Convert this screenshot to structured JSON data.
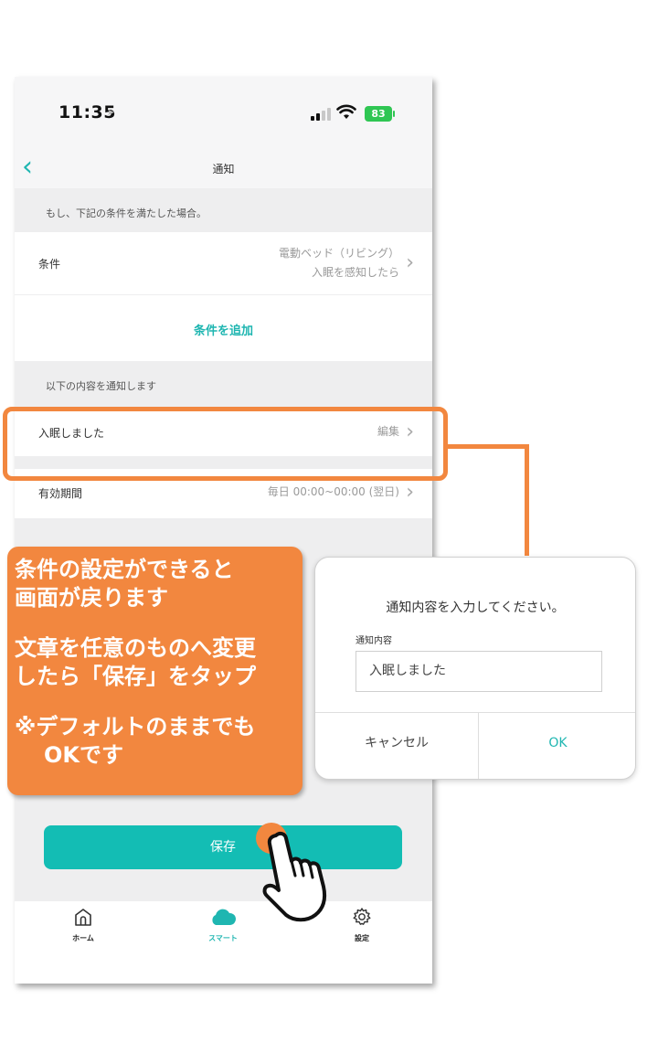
{
  "statusbar": {
    "time": "11:35",
    "location_glyph": "➤",
    "battery": "83"
  },
  "navbar": {
    "back": "‹",
    "title": "通知"
  },
  "condition_section": {
    "header": "もし、下記の条件を満たした場合。",
    "row_label": "条件",
    "row_value_line1": "電動ベッド（リビング）",
    "row_value_line2": "入眠を感知したら",
    "add_link": "条件を追加"
  },
  "notify_section": {
    "header": "以下の内容を通知します",
    "row_label": "入眠しました",
    "row_value": "編集"
  },
  "period_row": {
    "label": "有効期間",
    "value": "毎日 00:00~00:00 (翌日)"
  },
  "save_button": "保存",
  "tabbar": {
    "items": [
      {
        "label": "ホーム",
        "icon": "home-icon"
      },
      {
        "label": "スマート",
        "icon": "cloud-icon"
      },
      {
        "label": "設定",
        "icon": "gear-icon"
      }
    ]
  },
  "callout": {
    "lines1": [
      "条件の設定ができると",
      "画面が戻ります"
    ],
    "lines2": [
      "文章を任意のものへ変更",
      "したら「保存」をタップ"
    ],
    "lines3": [
      "※デフォルトのままでも",
      "OKです"
    ]
  },
  "dialog": {
    "title": "通知内容を入力してください。",
    "field_label": "通知内容",
    "field_value": "入眠しました",
    "cancel": "キャンセル",
    "ok": "OK"
  },
  "colors": {
    "accent": "#13bdb4",
    "annotation": "#f2873f",
    "background": "#eeeeef"
  }
}
